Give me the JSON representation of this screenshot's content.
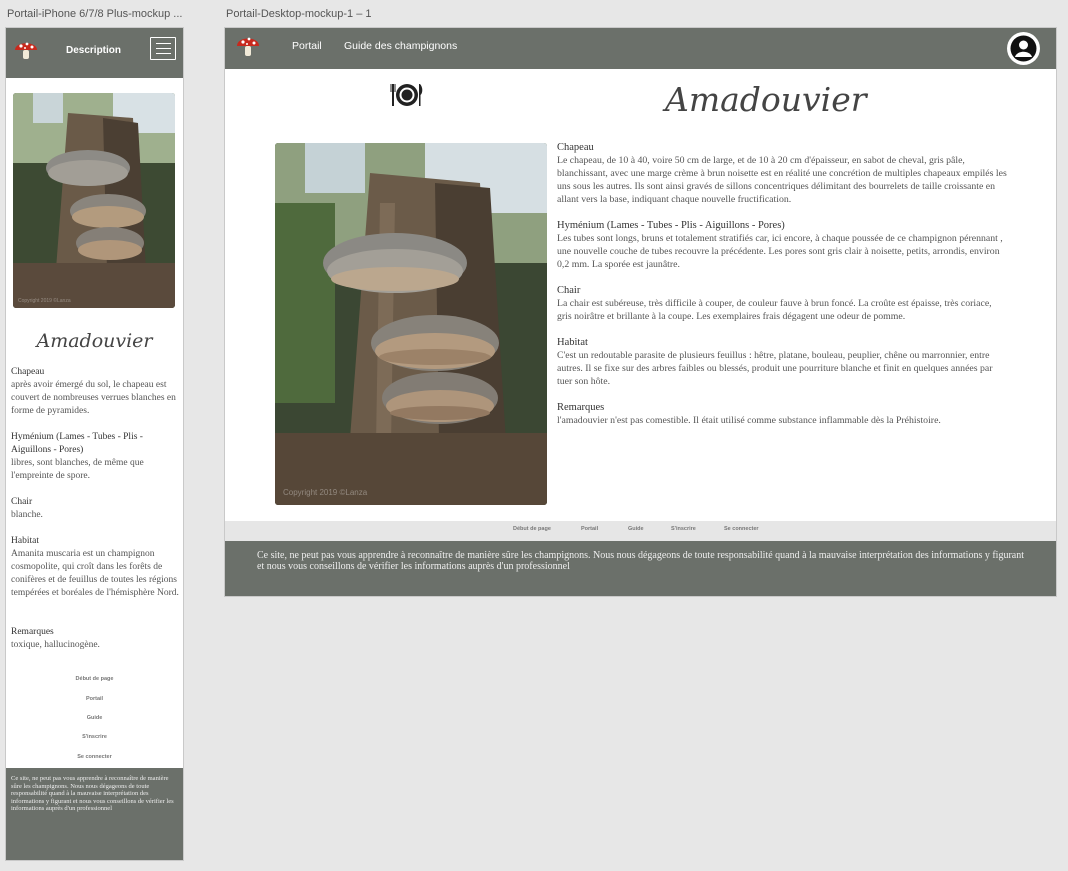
{
  "artboards": {
    "mobile_label": "Portail-iPhone 6/7/8 Plus-mockup ...",
    "desktop_label": "Portail-Desktop-mockup-1 – 1"
  },
  "mobile": {
    "nav_title": "Description",
    "heading": "Amadouvier",
    "photo_copyright": "Copyright 2019 ©Lanza",
    "sections": [
      {
        "title": "Chapeau",
        "text": "après avoir émergé du sol, le chapeau est couvert de nombreuses verrues blanches en forme de pyramides."
      },
      {
        "title": "Hyménium (Lames - Tubes - Plis - Aiguillons - Pores)",
        "text": "libres, sont blanches, de même que l'empreinte de spore."
      },
      {
        "title": "Chair",
        "text": "blanche."
      },
      {
        "title": "Habitat",
        "text": "Amanita muscaria est un champignon cosmopolite, qui croît dans les forêts de conifères et de feuillus de toutes les régions tempérées et boréales de l'hémisphère Nord."
      },
      {
        "title": "Remarques",
        "text": "toxique, hallucinogène."
      }
    ],
    "footer_nav": [
      "Début de page",
      "Portail",
      "Guide",
      "S'inscrire",
      "Se connecter"
    ],
    "footer_text": "Ce site, ne peut pas vous apprendre à reconnaître de manière sûre les champignons. Nous nous dégageons de toute responsabilité quand à la mauvaise interprétation des informations y figurant et nous vous conseillons de vérifier les informations auprès d'un professionnel"
  },
  "desktop": {
    "nav_links": [
      "Portail",
      "Guide des champignons"
    ],
    "heading": "Amadouvier",
    "photo_copyright": "Copyright 2019 ©Lanza",
    "sections": [
      {
        "title": "Chapeau",
        "text": "Le chapeau, de 10 à 40, voire 50 cm de large, et de 10 à 20 cm d'épaisseur, en sabot de cheval, gris pâle, blanchissant, avec une marge crème à brun noisette est en réalité une concrétion de multiples chapeaux empilés les uns sous les autres. Ils sont ainsi gravés de sillons concentriques délimitant des bourrelets de taille croissante en allant vers la base, indiquant chaque nouvelle fructification."
      },
      {
        "title": "Hyménium (Lames - Tubes - Plis - Aiguillons - Pores)",
        "text": "Les tubes sont longs, bruns et totalement stratifiés car, ici encore, à chaque poussée de ce champignon pérennant , une nouvelle couche de tubes recouvre la précédente. Les pores sont gris clair à noisette, petits, arrondis, environ 0,2 mm. La sporée est jaunâtre."
      },
      {
        "title": "Chair",
        "text": "La chair est subéreuse, très difficile à couper, de couleur fauve à brun foncé. La croûte est épaisse, très coriace, gris noirâtre et brillante à la coupe. Les exemplaires frais dégagent une odeur de pomme."
      },
      {
        "title": "Habitat",
        "text": "C'est un redoutable parasite de plusieurs feuillus : hêtre, platane, bouleau, peuplier, chêne ou marronnier, entre autres. Il se fixe sur des arbres faibles ou blessés, produit une pourriture blanche et finit en quelques années par tuer son hôte."
      },
      {
        "title": "Remarques",
        "text": "l'amadouvier n'est pas comestible. Il était utilisé comme substance inflammable dès la Préhistoire."
      }
    ],
    "footer_nav": [
      "Début de page",
      "Portail",
      "Guide",
      "S'inscrire",
      "Se connecter"
    ],
    "footer_text": "Ce site, ne peut pas vous apprendre à reconnaître de manière sûre les champignons. Nous nous dégageons de toute responsabilité quand à la mauvaise interprétation des informations y figurant et nous vous conseillons de vérifier les informations auprès d'un professionnel"
  },
  "icons": {
    "logo": "mushroom-icon",
    "menu": "hamburger-icon",
    "account": "user-avatar-icon",
    "food": "plate-cutlery-icon"
  },
  "colors": {
    "nav_bg": "#6b706a",
    "footer_bg": "#6b706a",
    "footer_nav_bg": "#e6e6e6"
  }
}
